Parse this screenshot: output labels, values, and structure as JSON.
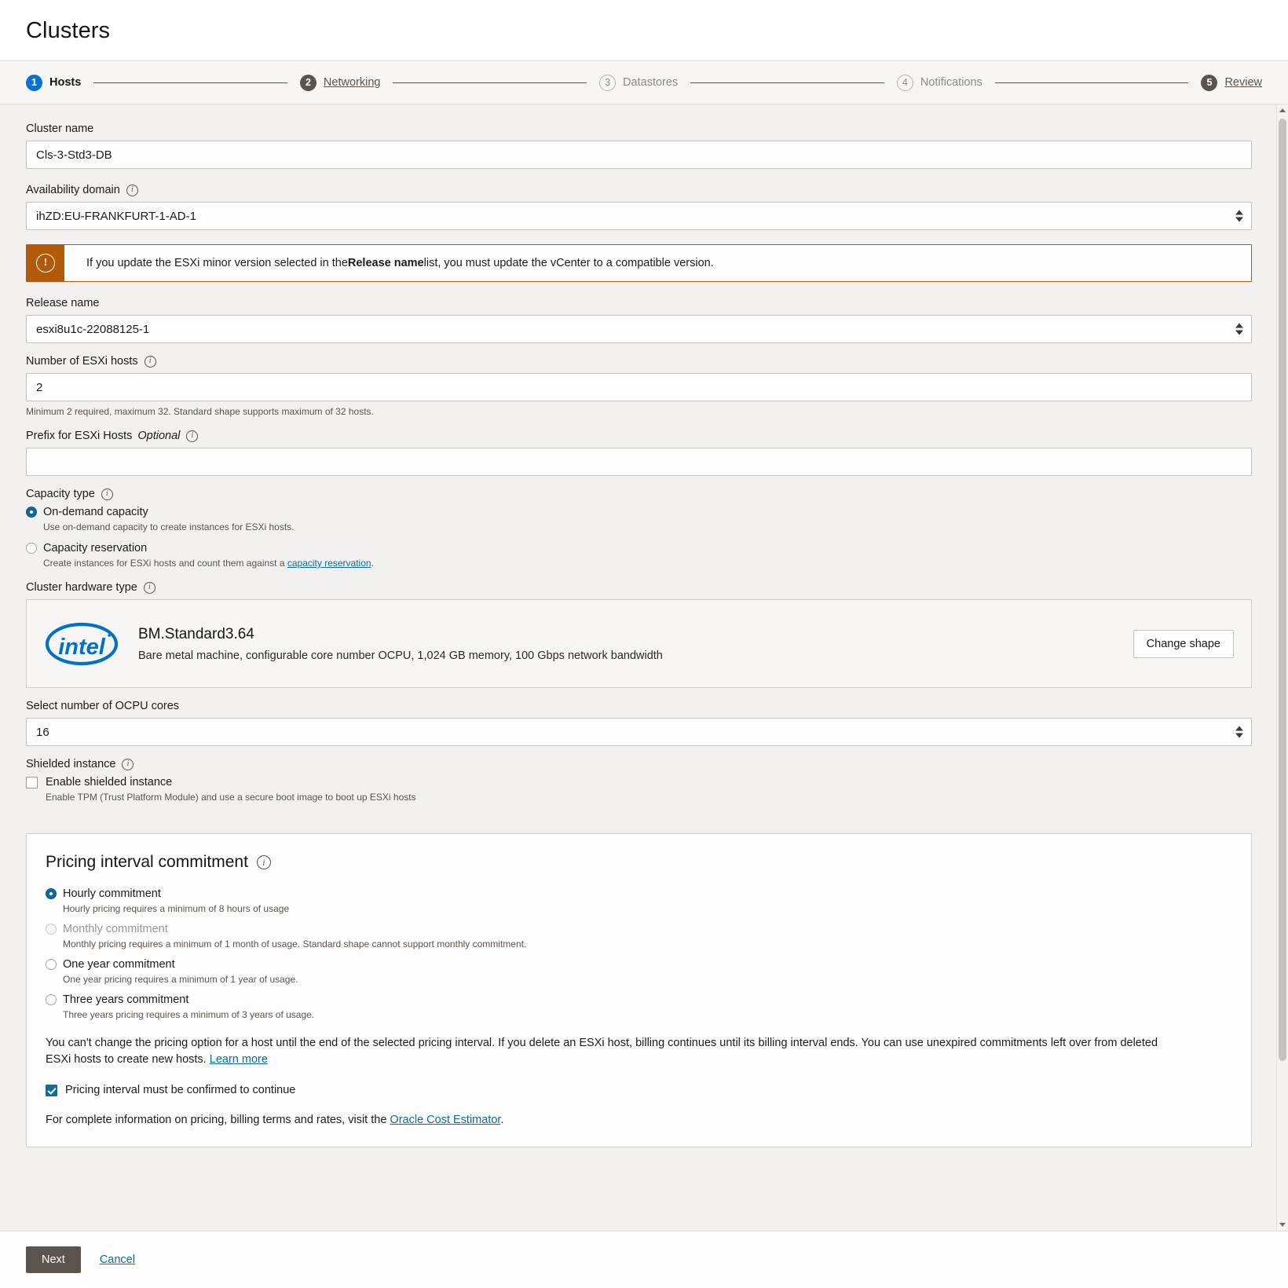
{
  "header": {
    "title": "Clusters"
  },
  "stepper": {
    "steps": [
      {
        "num": "1",
        "label": "Hosts",
        "state": "current"
      },
      {
        "num": "2",
        "label": "Networking",
        "state": "visited"
      },
      {
        "num": "3",
        "label": "Datastores",
        "state": "todo"
      },
      {
        "num": "4",
        "label": "Notifications",
        "state": "todo"
      },
      {
        "num": "5",
        "label": "Review",
        "state": "visited"
      }
    ]
  },
  "form": {
    "cluster_name": {
      "label": "Cluster name",
      "value": "Cls-3-Std3-DB",
      "placeholder": ""
    },
    "availability_domain": {
      "label": "Availability domain",
      "value": "ihZD:EU-FRANKFURT-1-AD-1"
    },
    "warning": {
      "text_before": "If you update the ESXi minor version selected in the ",
      "bold": "Release name",
      "text_after": " list, you must update the vCenter to a compatible version.",
      "icon": "warning-exclamation-icon",
      "color": "#b3590a"
    },
    "release_name": {
      "label": "Release name",
      "value": "esxi8u1c-22088125-1"
    },
    "esxi_hosts": {
      "label": "Number of ESXi hosts",
      "value": "2",
      "help": "Minimum 2 required, maximum 32. Standard shape supports maximum of 32 hosts."
    },
    "prefix": {
      "label": "Prefix for ESXi Hosts",
      "optional": "Optional",
      "value": "",
      "placeholder": ""
    },
    "capacity_type": {
      "label": "Capacity type",
      "options": [
        {
          "label": "On-demand capacity",
          "desc": "Use on-demand capacity to create instances for ESXi hosts.",
          "selected": true
        },
        {
          "label": "Capacity reservation",
          "desc_before": "Create instances for ESXi hosts and count them against a ",
          "desc_link": "capacity reservation",
          "desc_after": ".",
          "selected": false
        }
      ]
    },
    "hardware_type": {
      "label": "Cluster hardware type",
      "logo": "intel-logo",
      "shape_name": "BM.Standard3.64",
      "shape_desc": "Bare metal machine, configurable core number OCPU, 1,024 GB memory, 100 Gbps network bandwidth",
      "change_button": "Change shape"
    },
    "ocpu": {
      "label": "Select number of OCPU cores",
      "value": "16"
    },
    "shielded": {
      "label": "Shielded instance",
      "checkbox_label": "Enable shielded instance",
      "checked": false,
      "desc": "Enable TPM (Trust Platform Module) and use a secure boot image to boot up ESXi hosts"
    }
  },
  "pricing": {
    "title": "Pricing interval commitment",
    "options": [
      {
        "label": "Hourly commitment",
        "desc": "Hourly pricing requires a minimum of 8 hours of usage",
        "selected": true,
        "disabled": false
      },
      {
        "label": "Monthly commitment",
        "desc": "Monthly pricing requires a minimum of 1 month of usage. Standard shape cannot support monthly commitment.",
        "selected": false,
        "disabled": true
      },
      {
        "label": "One year commitment",
        "desc": "One year pricing requires a minimum of 1 year of usage.",
        "selected": false,
        "disabled": false
      },
      {
        "label": "Three years commitment",
        "desc": "Three years pricing requires a minimum of 3 years of usage.",
        "selected": false,
        "disabled": false
      }
    ],
    "note_before": "You can't change the pricing option for a host until the end of the selected pricing interval. If you delete an ESXi host, billing continues until its billing interval ends. You can use unexpired commitments left over from deleted ESXi hosts to create new hosts. ",
    "note_link": "Learn more",
    "confirm_label": "Pricing interval must be confirmed to continue",
    "confirm_checked": true,
    "footer_before": "For complete information on pricing, billing terms and rates, visit the ",
    "footer_link": "Oracle Cost Estimator",
    "footer_after": "."
  },
  "footer": {
    "next_label": "Next",
    "cancel_label": "Cancel"
  }
}
